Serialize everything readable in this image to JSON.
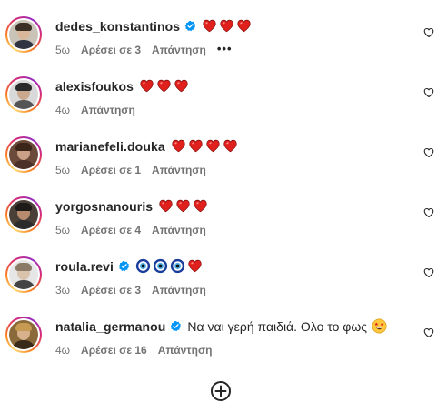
{
  "comments": [
    {
      "username": "dedes_konstantinos",
      "verified": true,
      "emojis": [
        "red-heart",
        "red-heart",
        "red-heart"
      ],
      "text": "",
      "time": "5ω",
      "likes": "Αρέσει σε 3",
      "reply": "Απάντηση",
      "more": "•••",
      "avatar_colors": {
        "bg": "#c9c3b8",
        "hair": "#3a2e25",
        "face": "#d8b79a",
        "body": "#2f3440"
      }
    },
    {
      "username": "alexisfoukos",
      "verified": false,
      "emojis": [
        "red-heart",
        "red-heart",
        "red-heart"
      ],
      "text": "",
      "time": "4ω",
      "likes": "",
      "reply": "Απάντηση",
      "avatar_colors": {
        "bg": "#d9d9d9",
        "hair": "#2a2a2a",
        "face": "#c9a88d",
        "body": "#555555"
      }
    },
    {
      "username": "marianefeli.douka",
      "verified": false,
      "emojis": [
        "red-heart",
        "red-heart",
        "red-heart",
        "red-heart"
      ],
      "text": "",
      "time": "5ω",
      "likes": "Αρέσει σε 1",
      "reply": "Απάντηση",
      "avatar_colors": {
        "bg": "#6b4a3a",
        "hair": "#3b2418",
        "face": "#caa087",
        "body": "#4a3026"
      }
    },
    {
      "username": "yorgosnanouris",
      "verified": false,
      "emojis": [
        "red-heart",
        "red-heart",
        "red-heart"
      ],
      "text": "",
      "time": "5ω",
      "likes": "Αρέσει σε 4",
      "reply": "Απάντηση",
      "avatar_colors": {
        "bg": "#4a4038",
        "hair": "#1e1a17",
        "face": "#b78c6e",
        "body": "#2b2b2b"
      }
    },
    {
      "username": "roula.revi",
      "verified": true,
      "emojis": [
        "nazar-amulet",
        "nazar-amulet",
        "nazar-amulet",
        "red-heart"
      ],
      "text": "",
      "time": "3ω",
      "likes": "Αρέσει σε 3",
      "reply": "Απάντηση",
      "avatar_colors": {
        "bg": "#e6e6e6",
        "hair": "#8a7a66",
        "face": "#d9c3ad",
        "body": "#444444"
      }
    },
    {
      "username": "natalia_germanou",
      "verified": true,
      "emojis": [],
      "text": "Να ναι γερή παιδιά. Ολο το φως",
      "trailing_emoji": "star-struck",
      "time": "4ω",
      "likes": "Αρέσει σε 16",
      "reply": "Απάντηση",
      "avatar_colors": {
        "bg": "#8a6a3a",
        "hair": "#c69a52",
        "face": "#d7b08c",
        "body": "#3a2a1a"
      }
    }
  ],
  "colors": {
    "verified_blue": "#0095f6",
    "heart_red": "#e0201c",
    "meta_gray": "#737373",
    "text_dark": "#262626"
  },
  "icons": {
    "like": "heart-outline-icon",
    "load_more": "plus-circle-icon"
  }
}
